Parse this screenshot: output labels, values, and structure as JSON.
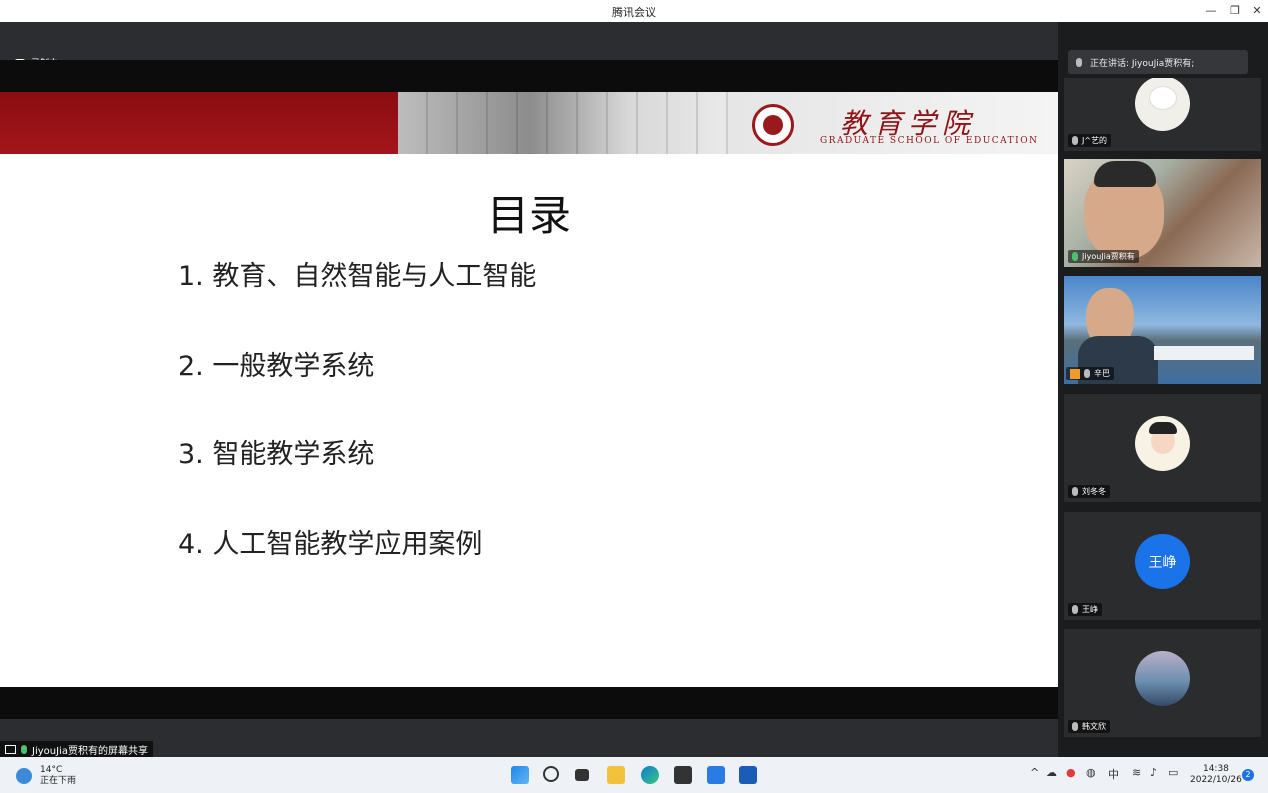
{
  "window": {
    "title": "腾讯会议",
    "minimize": "—",
    "restore": "❐",
    "close": "✕"
  },
  "recording": {
    "label": "录制中"
  },
  "slide": {
    "school_cn": "教育学院",
    "school_en": "GRADUATE SCHOOL OF EDUCATION",
    "title": "目录",
    "items": [
      "1.  教育、自然智能与人工智能",
      "2.  一般教学系统",
      "3.  智能教学系统",
      "4.  人工智能教学应用案例"
    ]
  },
  "share": {
    "label": "JiyouJia贾积有的屏幕共享"
  },
  "panel": {
    "speaking": "正在讲话: JiyouJia贾积有;",
    "participants": [
      {
        "name": "J^艺的"
      },
      {
        "name": "JiyouJia贾积有"
      },
      {
        "name": "辛巴"
      },
      {
        "name": "刘冬冬"
      },
      {
        "name": "王峥",
        "avatar_text": "王峥"
      },
      {
        "name": "韩文欣"
      }
    ]
  },
  "taskbar": {
    "weather_temp": "14°C",
    "weather_desc": "正在下雨",
    "ime": "中",
    "time": "14:38",
    "date": "2022/10/26",
    "notifications": "2"
  },
  "colors": {
    "brand_red": "#9a1a1c",
    "accent_blue": "#1a73e8"
  }
}
